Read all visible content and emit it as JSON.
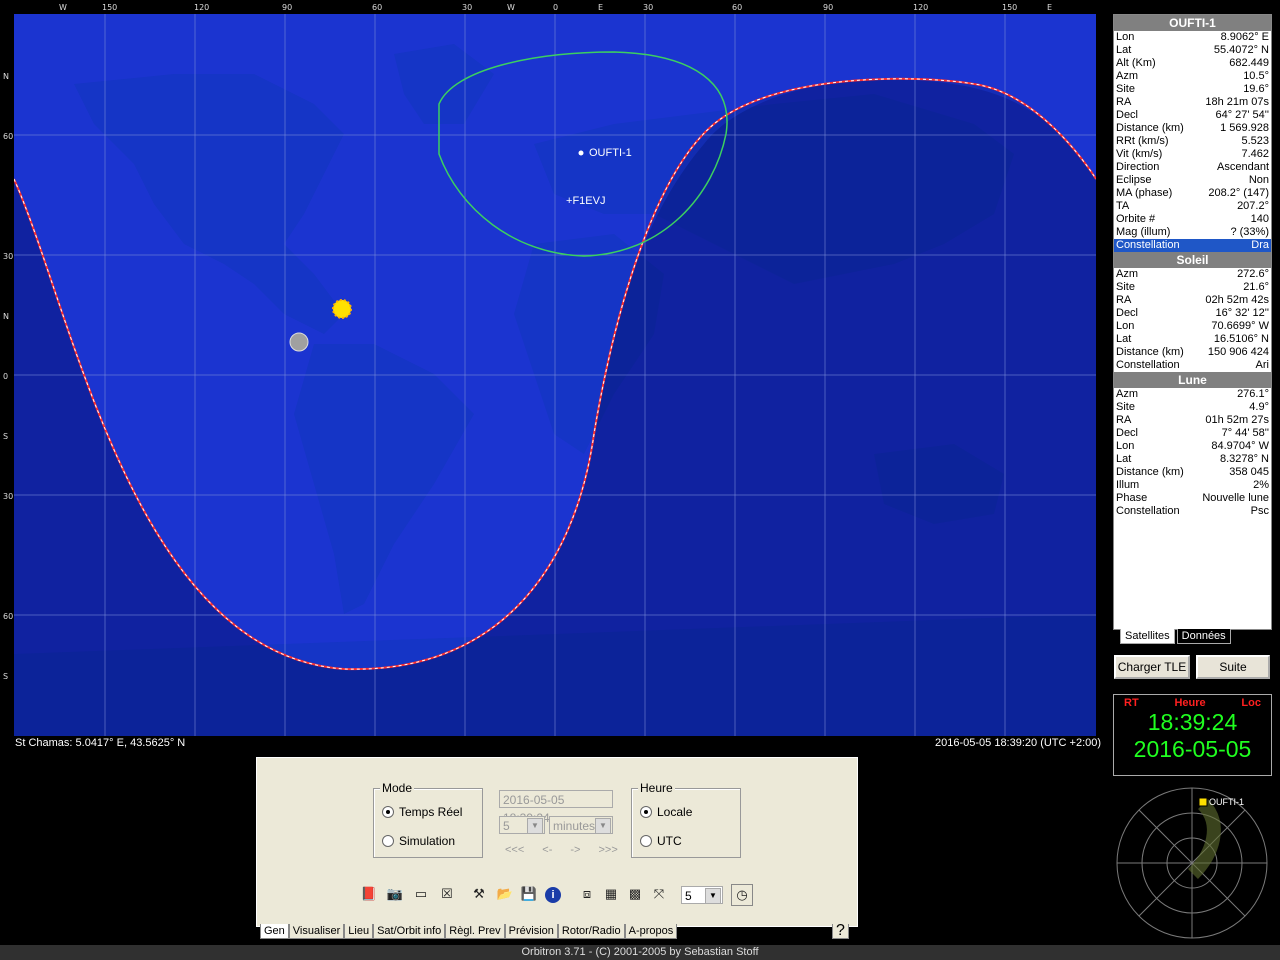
{
  "map": {
    "top_ticks": [
      "W",
      "150",
      "120",
      "90",
      "60",
      "30",
      "W",
      "0",
      "E",
      "30",
      "60",
      "90",
      "120",
      "150",
      "E"
    ],
    "left_ticks": [
      "N",
      "60",
      "30",
      "N",
      "0",
      "S",
      "30",
      "60",
      "S"
    ],
    "satellite_label": "OUFTI-1",
    "station_label": "F1EVJ",
    "location_text": "St Chamas: 5.0417° E, 43.5625° N",
    "datetime_text": "2016-05-05 18:39:20 (UTC +2:00)"
  },
  "panel": {
    "sat_title": "OUFTI-1",
    "sat_rows": [
      [
        "Lon",
        "8.9062° E"
      ],
      [
        "Lat",
        "55.4072° N"
      ],
      [
        "Alt (Km)",
        "682.449"
      ],
      [
        "Azm",
        "10.5°"
      ],
      [
        "Site",
        "19.6°"
      ],
      [
        "RA",
        "18h 21m 07s"
      ],
      [
        "Decl",
        "64° 27' 54''"
      ],
      [
        "Distance (km)",
        "1 569.928"
      ],
      [
        "RRt (km/s)",
        "5.523"
      ],
      [
        "Vit (km/s)",
        "7.462"
      ],
      [
        "Direction",
        "Ascendant"
      ],
      [
        "Eclipse",
        "Non"
      ],
      [
        "MA (phase)",
        "208.2° (147)"
      ],
      [
        "TA",
        "207.2°"
      ],
      [
        "Orbite #",
        "140"
      ],
      [
        "Mag (illum)",
        "? (33%)"
      ],
      [
        "Constellation",
        "Dra"
      ]
    ],
    "sun_title": "Soleil",
    "sun_rows": [
      [
        "Azm",
        "272.6°"
      ],
      [
        "Site",
        "21.6°"
      ],
      [
        "RA",
        "02h 52m 42s"
      ],
      [
        "Decl",
        "16° 32' 12''"
      ],
      [
        "Lon",
        "70.6699° W"
      ],
      [
        "Lat",
        "16.5106° N"
      ],
      [
        "Distance (km)",
        "150 906 424"
      ],
      [
        "Constellation",
        "Ari"
      ]
    ],
    "moon_title": "Lune",
    "moon_rows": [
      [
        "Azm",
        "276.1°"
      ],
      [
        "Site",
        "4.9°"
      ],
      [
        "RA",
        "01h 52m 27s"
      ],
      [
        "Decl",
        "7° 44' 58''"
      ],
      [
        "Lon",
        "84.9704° W"
      ],
      [
        "Lat",
        "8.3278° N"
      ],
      [
        "Distance (km)",
        "358 045"
      ],
      [
        "Illum",
        "2%"
      ],
      [
        "Phase",
        "Nouvelle lune"
      ],
      [
        "Constellation",
        "Psc"
      ]
    ],
    "tabs": [
      "Satellites",
      "Données"
    ],
    "load_tle": "Charger TLE",
    "next": "Suite"
  },
  "clock": {
    "rt": "RT",
    "heure": "Heure",
    "loc": "Loc",
    "time": "18:39:24",
    "date": "2016-05-05"
  },
  "radar": {
    "sat_label": "OUFTI-1"
  },
  "controls": {
    "mode_title": "Mode",
    "mode_realtime": "Temps Réel",
    "mode_sim": "Simulation",
    "sim_datetime": "2016-05-05 18:39:24",
    "step_value": "5",
    "step_unit": "minutes",
    "nav": [
      "<<<",
      "<-",
      "->",
      ">>>"
    ],
    "heure_title": "Heure",
    "heure_local": "Locale",
    "heure_utc": "UTC",
    "refresh_value": "5"
  },
  "bottom_tabs": [
    "Gen",
    "Visualiser",
    "Lieu",
    "Sat/Orbit info",
    "Règl. Prev",
    "Prévision",
    "Rotor/Radio",
    "A-propos"
  ],
  "help_tab": "?",
  "status": "Orbitron 3.71 - (C) 2001-2005 by Sebastian Stoff"
}
